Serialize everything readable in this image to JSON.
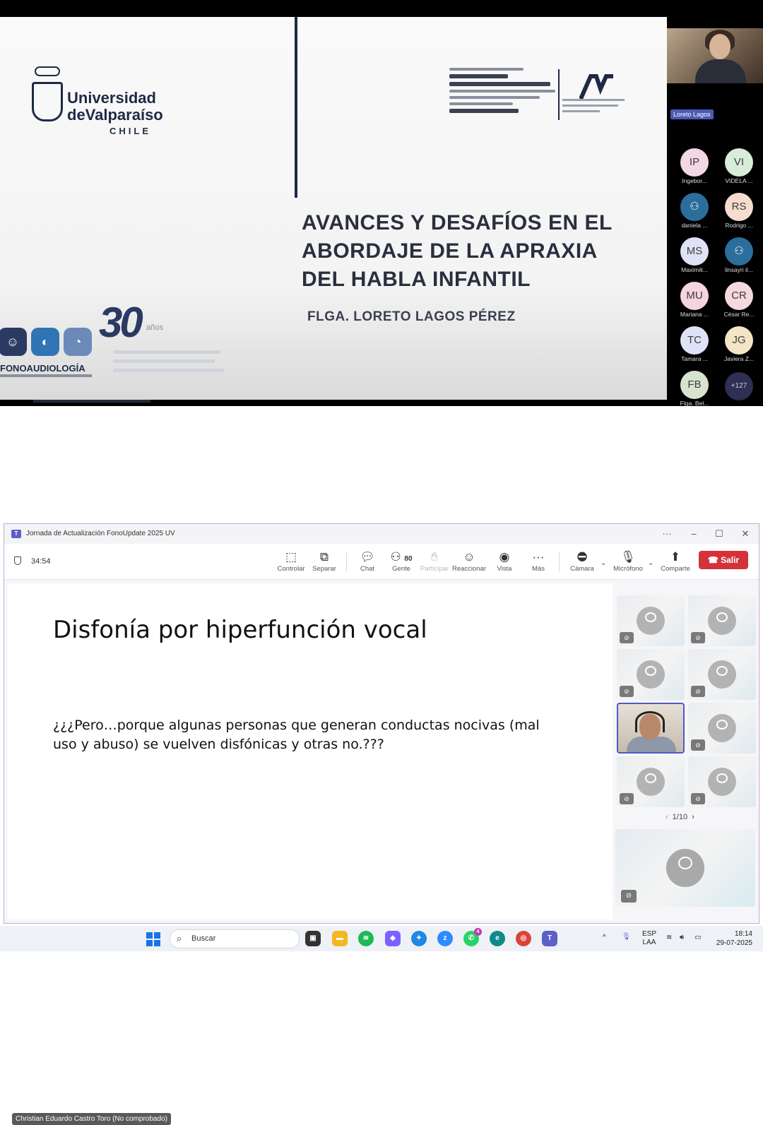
{
  "top_meeting": {
    "slide": {
      "university_line1": "Universidad",
      "university_line2": "deValparaíso",
      "university_country": "CHILE",
      "title_lines": [
        "AVANCES Y DESAFÍOS EN EL",
        "ABORDAJE DE LA APRAXIA",
        "DEL HABLA INFANTIL"
      ],
      "author": "FLGA. LORETO LAGOS PÉREZ",
      "fono_label": "FONOAUDIOLOGÍA",
      "anniversary": "30",
      "anniversary_suffix": "años"
    },
    "speaker_tag": "Loreto Lagos",
    "participants": [
      {
        "initials": "IP",
        "name": "Ingebor...",
        "color": "#f3d7e4"
      },
      {
        "initials": "VI",
        "name": "VIDELA ...",
        "color": "#d8ecd9"
      },
      {
        "initials": "",
        "name": "daniela ...",
        "color": "#2c6e9b",
        "icon": "person-icon"
      },
      {
        "initials": "RS",
        "name": "Rodrigo ...",
        "color": "#f6dccf"
      },
      {
        "initials": "MS",
        "name": "Maximili...",
        "color": "#dfe2f6"
      },
      {
        "initials": "",
        "name": "linsayri il...",
        "color": "#2c6e9b",
        "icon": "person-icon"
      },
      {
        "initials": "MU",
        "name": "Mariana ...",
        "color": "#f6d3e1"
      },
      {
        "initials": "CR",
        "name": "César Re...",
        "color": "#f6d9df"
      },
      {
        "initials": "TC",
        "name": "Tamara ...",
        "color": "#dfe2f6"
      },
      {
        "initials": "JG",
        "name": "Javiera Z...",
        "color": "#f4e6c5"
      },
      {
        "initials": "FB",
        "name": "Flga. Bel...",
        "color": "#d6e3cf"
      }
    ],
    "more_count": "+127"
  },
  "teams": {
    "window_title": "Jornada de Actualización FonoUpdate 2025 UV",
    "timer": "34:54",
    "toolbar": {
      "controlar": "Controlar",
      "separar": "Separar",
      "chat": "Chat",
      "gente": "Gente",
      "gente_count": "80",
      "participar": "Participar",
      "reaccionar": "Reaccionar",
      "vista": "Vista",
      "mas": "Más",
      "camara": "Cámara",
      "microfono": "Micrófono",
      "comparte": "Comparte",
      "salir": "Salir"
    },
    "slide_title": "Disfonía por hiperfunción vocal",
    "slide_body": "¿¿¿Pero…porque algunas personas que generan conductas nocivas (mal uso y abuso) se vuelven disfónicas y otras no.???",
    "presenter_name": "Christian Eduardo Castro Toro (No comprobado)",
    "pager": "1/10"
  },
  "taskbar": {
    "search_placeholder": "Buscar",
    "lang_top": "ESP",
    "lang_bottom": "LAA",
    "time": "18:14",
    "date": "29-07-2025",
    "whatsapp_badge": "4",
    "accent": "#1a73e8"
  }
}
